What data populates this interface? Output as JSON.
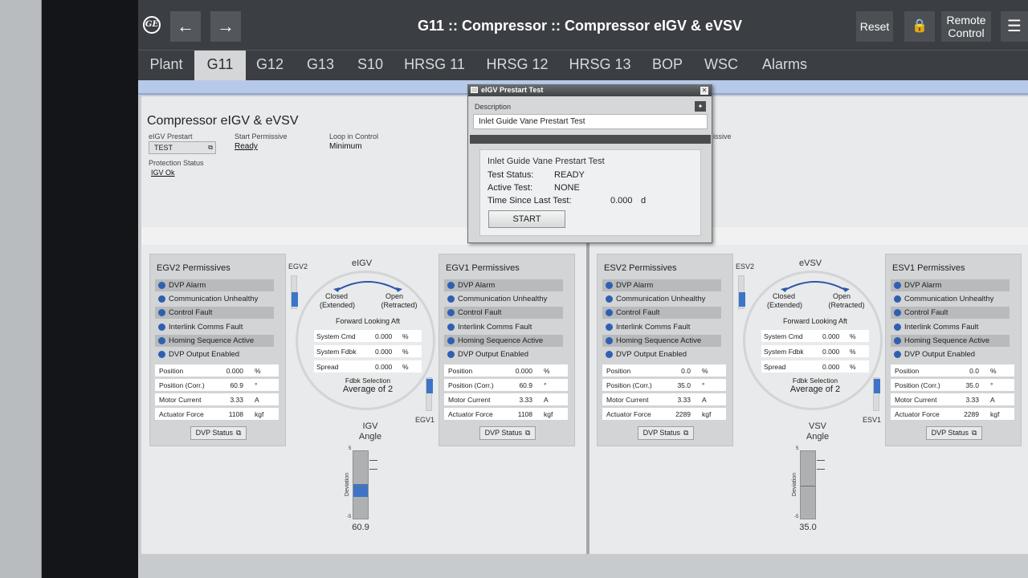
{
  "app": {
    "title": "G11 :: Compressor :: Compressor eIGV & eVSV",
    "back_icon": "←",
    "forward_icon": "→",
    "logo": "GE",
    "reset_label": "Reset",
    "lock_icon": "🔒",
    "remote_label": "Remote Control",
    "menu_icon": "☰"
  },
  "tabs": [
    "Plant",
    "G11",
    "G12",
    "G13",
    "S10",
    "HRSG 11",
    "HRSG 12",
    "HRSG 13",
    "BOP",
    "WSC",
    "Alarms"
  ],
  "page": {
    "heading": "Compressor eIGV & eVSV",
    "eigv_prestart_label": "eIGV Prestart",
    "eigv_prestart_value": "TEST",
    "start_permissive_label": "Start Permissive",
    "start_permissive_value": "Ready",
    "loop_label": "Loop in Control",
    "loop_value": "Minimum",
    "protection_label": "Protection Status",
    "protection_value": "IGV Ok",
    "hidden_label_fragment": "issive"
  },
  "dialog": {
    "title": "eIGV Prestart Test",
    "description_label": "Description",
    "description_value": "Inlet Guide Vane Prestart Test",
    "section_title": "Inlet Guide Vane Prestart Test",
    "test_status_label": "Test Status:",
    "test_status_value": "READY",
    "active_test_label": "Active Test:",
    "active_test_value": "NONE",
    "time_label": "Time Since Last Test:",
    "time_value": "0.000",
    "time_unit": "d",
    "start_label": "START"
  },
  "permissive_items": [
    "DVP Alarm",
    "Communication Unhealthy",
    "Control Fault",
    "Interlink Comms Fault",
    "Homing Sequence Active",
    "DVP Output Enabled"
  ],
  "kv_labels": [
    "Position",
    "Position (Corr.)",
    "Motor Current",
    "Actuator Force"
  ],
  "dvp_status_label": "DVP Status",
  "cards": [
    {
      "title": "EGV2 Permissives",
      "values": [
        "0.000",
        "60.9",
        "3.33",
        "1108"
      ],
      "units": [
        "%",
        "°",
        "A",
        "kgf"
      ]
    },
    {
      "title": "EGV1 Permissives",
      "values": [
        "0.000",
        "60.9",
        "3.33",
        "1108"
      ],
      "units": [
        "%",
        "°",
        "A",
        "kgf"
      ]
    },
    {
      "title": "ESV2 Permissives",
      "values": [
        "0.0",
        "35.0",
        "3.33",
        "2289"
      ],
      "units": [
        "%",
        "°",
        "A",
        "kgf"
      ]
    },
    {
      "title": "ESV1 Permissives",
      "values": [
        "0.0",
        "35.0",
        "3.33",
        "2289"
      ],
      "units": [
        "%",
        "°",
        "A",
        "kgf"
      ]
    }
  ],
  "dials": [
    {
      "title": "eIGV",
      "left_label": "EGV2",
      "right_label": "EGV1",
      "closed": "Closed",
      "closed_sub": "(Extended)",
      "open": "Open",
      "open_sub": "(Retracted)",
      "fla": "Forward Looking Aft",
      "rows": [
        [
          "System Cmd",
          "0.000",
          "%"
        ],
        [
          "System Fdbk",
          "0.000",
          "%"
        ],
        [
          "Spread",
          "0.000",
          "%"
        ]
      ],
      "fdbk_label": "Fdbk Selection",
      "fdbk_value": "Average of 2",
      "angle_label": "IGV",
      "angle_label2": "Angle",
      "angle_value": "60.9",
      "deviation": "Deviation",
      "top": "5",
      "bottom": "-5"
    },
    {
      "title": "eVSV",
      "left_label": "ESV2",
      "right_label": "ESV1",
      "closed": "Closed",
      "closed_sub": "(Extended)",
      "open": "Open",
      "open_sub": "(Retracted)",
      "fla": "Forward Looking Aft",
      "rows": [
        [
          "System Cmd",
          "0.000",
          "%"
        ],
        [
          "System Fdbk",
          "0.000",
          "%"
        ],
        [
          "Spread",
          "0.000",
          "%"
        ]
      ],
      "fdbk_label": "Fdbk Selection",
      "fdbk_value": "Average of 2",
      "angle_label": "VSV",
      "angle_label2": "Angle",
      "angle_value": "35.0",
      "deviation": "Deviation",
      "top": "5",
      "bottom": "-5"
    }
  ],
  "colors": {
    "accent": "#2f5fb0",
    "header": "#3b3e43",
    "active_tab": "#d4d6d8"
  }
}
